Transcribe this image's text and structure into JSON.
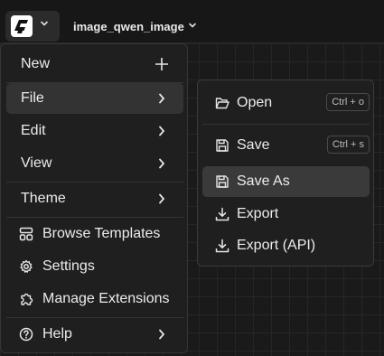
{
  "app": {
    "logo_icon": "comfy-logo-icon",
    "workflow_tab": "image_qwen_image"
  },
  "menu": {
    "items": [
      {
        "label": "New",
        "icon": "plus-icon"
      },
      {
        "label": "File",
        "icon": "chevron-right-icon"
      },
      {
        "label": "Edit",
        "icon": "chevron-right-icon"
      },
      {
        "label": "View",
        "icon": "chevron-right-icon"
      },
      {
        "label": "Theme",
        "icon": "chevron-right-icon"
      },
      {
        "label": "Browse Templates",
        "icon": "templates-icon"
      },
      {
        "label": "Settings",
        "icon": "gear-icon"
      },
      {
        "label": "Manage Extensions",
        "icon": "puzzle-icon"
      },
      {
        "label": "Help",
        "icon": "help-circle-icon"
      }
    ],
    "active": "File"
  },
  "file_submenu": {
    "items": [
      {
        "label": "Open",
        "shortcut": "Ctrl + o",
        "icon": "folder-open-icon"
      },
      {
        "label": "Save",
        "shortcut": "Ctrl + s",
        "icon": "save-icon"
      },
      {
        "label": "Save As",
        "icon": "save-icon"
      },
      {
        "label": "Export",
        "icon": "download-icon"
      },
      {
        "label": "Export (API)",
        "icon": "download-icon"
      }
    ],
    "highlighted": "Save As"
  },
  "colors": {
    "background": "#171717",
    "menu_bg": "#1f1f1f",
    "active_item": "#333333",
    "text": "#ececec"
  }
}
